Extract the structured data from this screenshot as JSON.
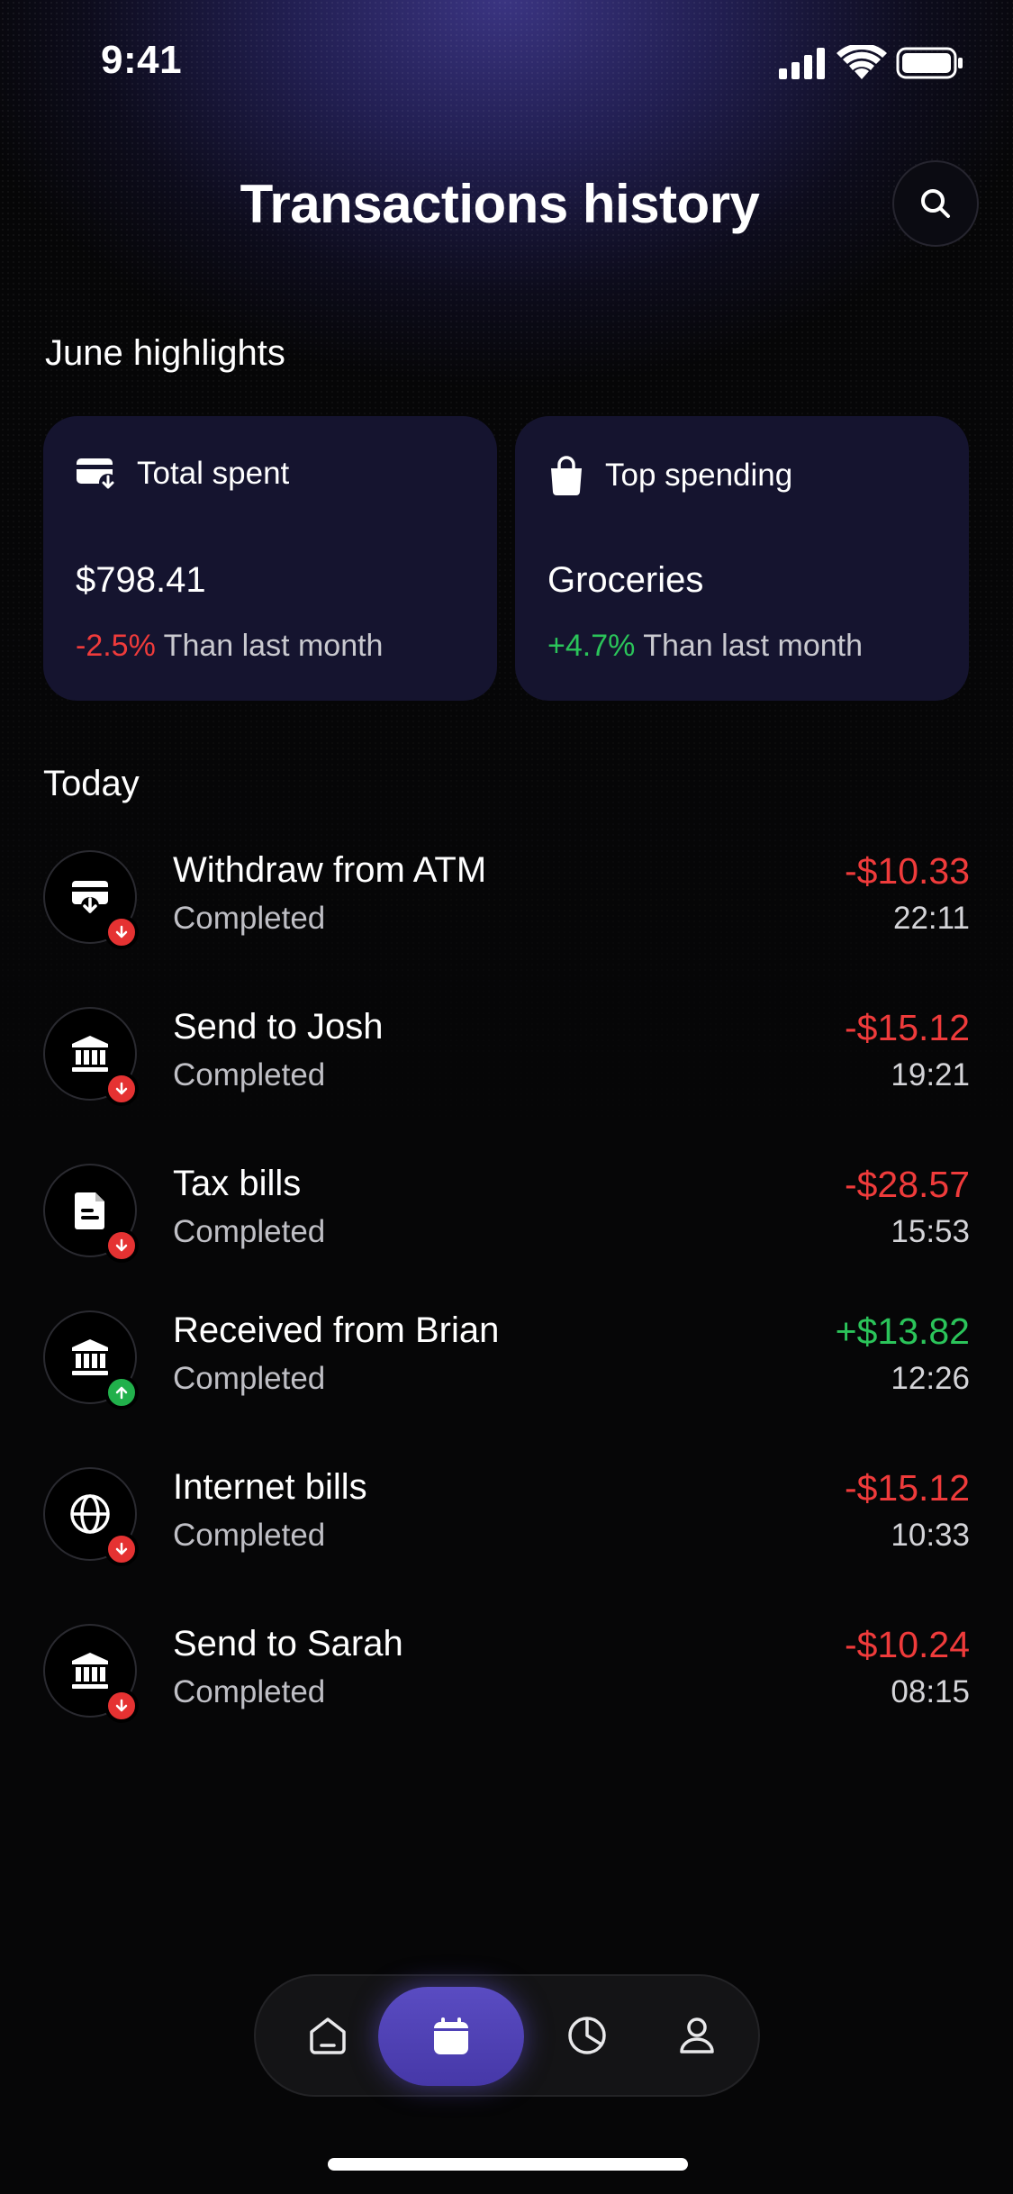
{
  "status_bar": {
    "time": "9:41"
  },
  "header": {
    "title": "Transactions history"
  },
  "highlights": {
    "title": "June highlights",
    "cards": [
      {
        "label": "Total spent",
        "value": "$798.41",
        "change": "-2.5%",
        "change_note": "Than last month",
        "icon": "card-icon"
      },
      {
        "label": "Top spending",
        "value": "Groceries",
        "change": "+4.7%",
        "change_note": "Than last month",
        "icon": "shopping-bag-icon"
      }
    ]
  },
  "today": {
    "title": "Today",
    "transactions": [
      {
        "name": "Withdraw from ATM",
        "status": "Completed",
        "amount": "-$10.33",
        "time": "22:11",
        "icon": "atm-icon",
        "direction": "out"
      },
      {
        "name": "Send to Josh",
        "status": "Completed",
        "amount": "-$15.12",
        "time": "19:21",
        "icon": "bank-icon",
        "direction": "out"
      },
      {
        "name": "Tax bills",
        "status": "Completed",
        "amount": "-$28.57",
        "time": "15:53",
        "icon": "document-icon",
        "direction": "out"
      },
      {
        "name": "Received from Brian",
        "status": "Completed",
        "amount": "+$13.82",
        "time": "12:26",
        "icon": "bank-icon",
        "direction": "in"
      },
      {
        "name": "Internet bills",
        "status": "Completed",
        "amount": "-$15.12",
        "time": "10:33",
        "icon": "globe-icon",
        "direction": "out"
      },
      {
        "name": "Send to Sarah",
        "status": "Completed",
        "amount": "-$10.24",
        "time": "08:15",
        "icon": "bank-icon",
        "direction": "out"
      }
    ]
  },
  "nav": {
    "items": [
      "home-icon",
      "calendar-icon",
      "pie-chart-icon",
      "profile-icon"
    ],
    "active": "calendar-icon"
  },
  "colors": {
    "negative": "#ef3b3b",
    "positive": "#2bc45a",
    "card_bg": "#15142f",
    "accent": "#5a4cc2"
  }
}
